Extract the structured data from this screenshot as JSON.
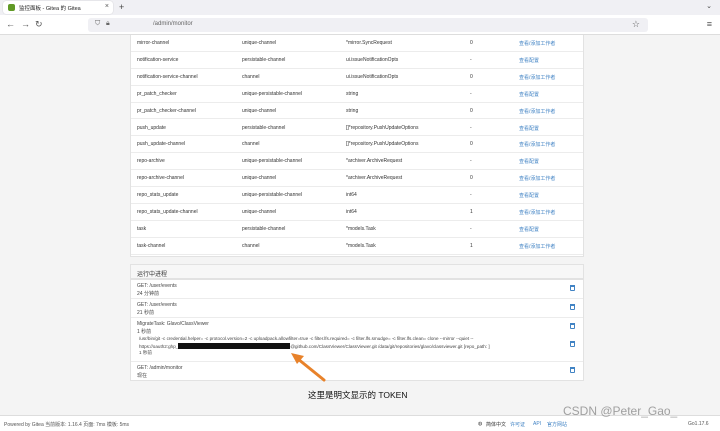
{
  "browser": {
    "tab_title": "监控面板 - Gitea 的 Gitea",
    "url": "/admin/monitor",
    "colors": {
      "gitea_green": "#609926",
      "link_blue": "#4183c4",
      "arrow_orange": "#e8822a"
    }
  },
  "queues": [
    {
      "name": "mirror-channel",
      "type": "unique-channel",
      "exemplar": "*mirror.SyncRequest",
      "workers": "0",
      "link": "查看/添加工作者"
    },
    {
      "name": "notification-service",
      "type": "persistable-channel",
      "exemplar": "ui.issueNotificationOpts",
      "workers": "-",
      "link": "查看配置"
    },
    {
      "name": "notification-service-channel",
      "type": "channel",
      "exemplar": "ui.issueNotificationOpts",
      "workers": "0",
      "link": "查看/添加工作者"
    },
    {
      "name": "pr_patch_checker",
      "type": "unique-persistable-channel",
      "exemplar": "string",
      "workers": "-",
      "link": "查看配置"
    },
    {
      "name": "pr_patch_checker-channel",
      "type": "unique-channel",
      "exemplar": "string",
      "workers": "0",
      "link": "查看/添加工作者"
    },
    {
      "name": "push_update",
      "type": "persistable-channel",
      "exemplar": "[]*repository.PushUpdateOptions",
      "workers": "-",
      "link": "查看配置"
    },
    {
      "name": "push_update-channel",
      "type": "channel",
      "exemplar": "[]*repository.PushUpdateOptions",
      "workers": "0",
      "link": "查看/添加工作者"
    },
    {
      "name": "repo-archive",
      "type": "unique-persistable-channel",
      "exemplar": "*archiver.ArchiveRequest",
      "workers": "-",
      "link": "查看配置"
    },
    {
      "name": "repo-archive-channel",
      "type": "unique-channel",
      "exemplar": "*archiver.ArchiveRequest",
      "workers": "0",
      "link": "查看/添加工作者"
    },
    {
      "name": "repo_stats_update",
      "type": "unique-persistable-channel",
      "exemplar": "int64",
      "workers": "-",
      "link": "查看配置"
    },
    {
      "name": "repo_stats_update-channel",
      "type": "unique-channel",
      "exemplar": "int64",
      "workers": "1",
      "link": "查看/添加工作者"
    },
    {
      "name": "task",
      "type": "persistable-channel",
      "exemplar": "*models.Task",
      "workers": "-",
      "link": "查看配置"
    },
    {
      "name": "task-channel",
      "type": "channel",
      "exemplar": "*models.Task",
      "workers": "1",
      "link": "查看/添加工作者"
    }
  ],
  "processes": {
    "title": "运行中进程",
    "items": [
      {
        "title": "GET: /user/events",
        "time": "24 分钟前"
      },
      {
        "title": "GET: /user/events",
        "time": "21 秒前"
      },
      {
        "title": "MigrateTask: Glavo/ClassViewer",
        "time": "1 秒前"
      }
    ],
    "child": {
      "cmd_line1": "/usr/bin/git -c credential.helper= -c protocol.version=2 -c uploadpack.allowfilter=true -c filter.lfs.required= -c filter.lfs.smudge= -c filter.lfs.clean= clone --mirror --quiet --",
      "cmd_pre": "https://oauth2:ghp_",
      "cmd_post": "@github.com/ClassViewer/ClassViewer.git /data/git/repositories/glavo/classviewer.git [repo_path: ]",
      "time": "1 秒前"
    },
    "last": {
      "title": "GET: /admin/monitor",
      "time": "现在"
    }
  },
  "annotation": {
    "text": "这里是明文显示的 TOKEN"
  },
  "footer": {
    "left": "Powered by Gitea 当前版本: 1.16.4 页面: 7ms 模板: 5ms",
    "language": "简体中文",
    "license": "许可证",
    "api": "API",
    "website": "官方网站",
    "go_version": "Go1.17.6"
  },
  "watermark": "CSDN @Peter_Gao_"
}
